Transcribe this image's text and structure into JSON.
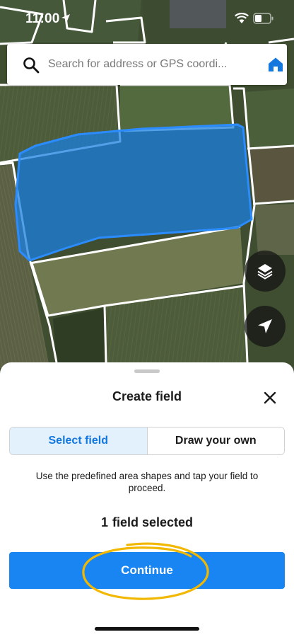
{
  "status_bar": {
    "time": "11:00",
    "icons": [
      "location-arrow-icon",
      "wifi-icon",
      "battery-icon"
    ]
  },
  "search": {
    "placeholder": "Search for address or GPS coordi...",
    "value": "",
    "icons": [
      "search-icon",
      "home-icon"
    ]
  },
  "map": {
    "background": "satellite-farmland",
    "selected_field_fill": "#1a7fe0",
    "selected_field_outline": "#2b8cff",
    "boundary_color": "#ffffff",
    "buttons": [
      "layers-icon",
      "location-arrow-icon"
    ]
  },
  "sheet": {
    "title": "Create field",
    "tabs": [
      {
        "label": "Select field",
        "active": true
      },
      {
        "label": "Draw your own",
        "active": false
      }
    ],
    "instructions": "Use the predefined area shapes and tap your field to proceed.",
    "selected": {
      "count": "1",
      "label": "field selected"
    },
    "continue_label": "Continue"
  },
  "colors": {
    "accent": "#1885f2",
    "tab_active_bg": "#e3f1fd",
    "tab_active_text": "#1377dd",
    "highlight_scribble": "#f2b800"
  }
}
